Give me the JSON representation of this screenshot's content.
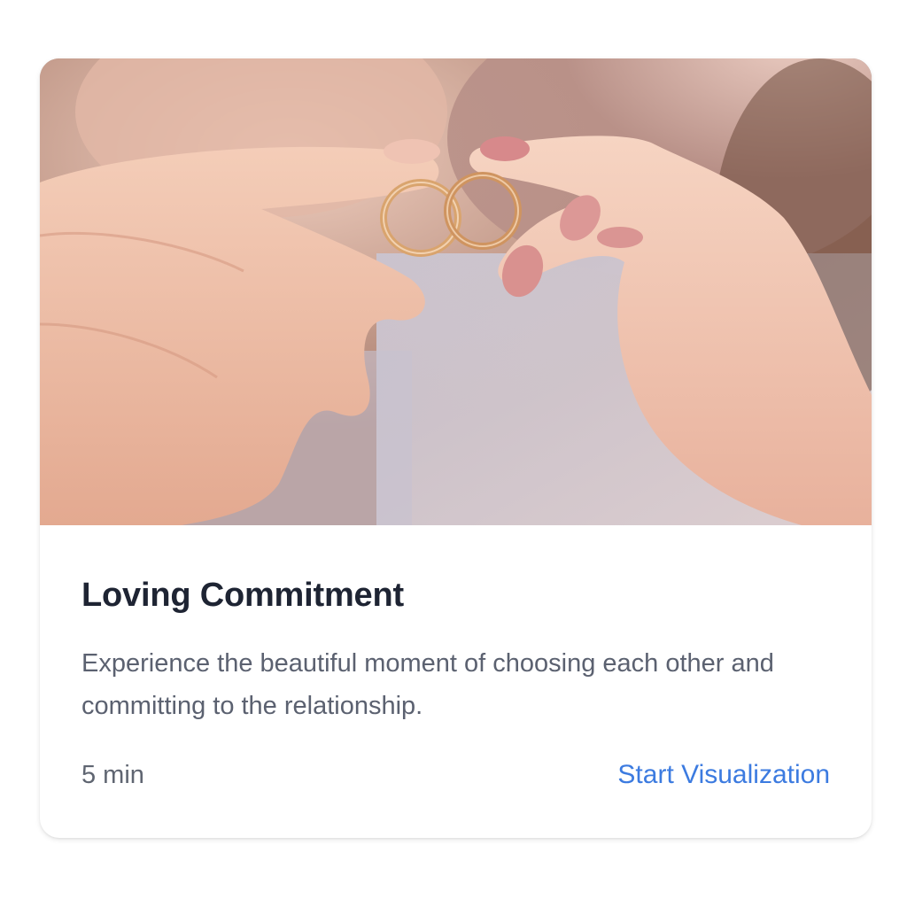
{
  "card": {
    "title": "Loving Commitment",
    "description": "Experience the beautiful moment of choosing each other and committing to the relationship.",
    "duration": "5 min",
    "action_label": "Start Visualization",
    "image_subject": "two hands holding interlocked wedding rings",
    "colors": {
      "title": "#1e2433",
      "body_text": "#5b6170",
      "link": "#3c7be0",
      "ring_gold": "#d9a46e"
    }
  }
}
